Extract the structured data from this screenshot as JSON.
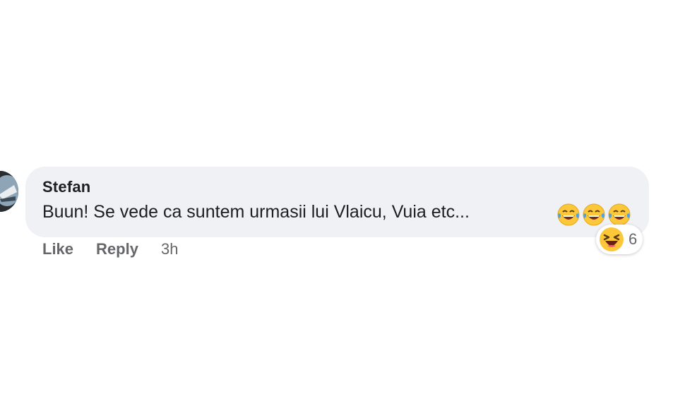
{
  "comment": {
    "author": "Stefan",
    "text": "Buun! Se vede ca suntem urmasii lui Vlaicu, Vuia etc...",
    "inline_emojis": [
      "face-with-tears-of-joy-icon",
      "face-with-tears-of-joy-icon",
      "face-with-tears-of-joy-icon"
    ],
    "reactions": {
      "icon": "haha-reaction-icon",
      "count": "6"
    },
    "actions": {
      "like_label": "Like",
      "reply_label": "Reply",
      "timestamp": "3h"
    }
  },
  "colors": {
    "bubble_bg": "#eff1f4",
    "text": "#1c1e21",
    "secondary_text": "#65676b",
    "emoji_yellow": "#fdc73a"
  }
}
